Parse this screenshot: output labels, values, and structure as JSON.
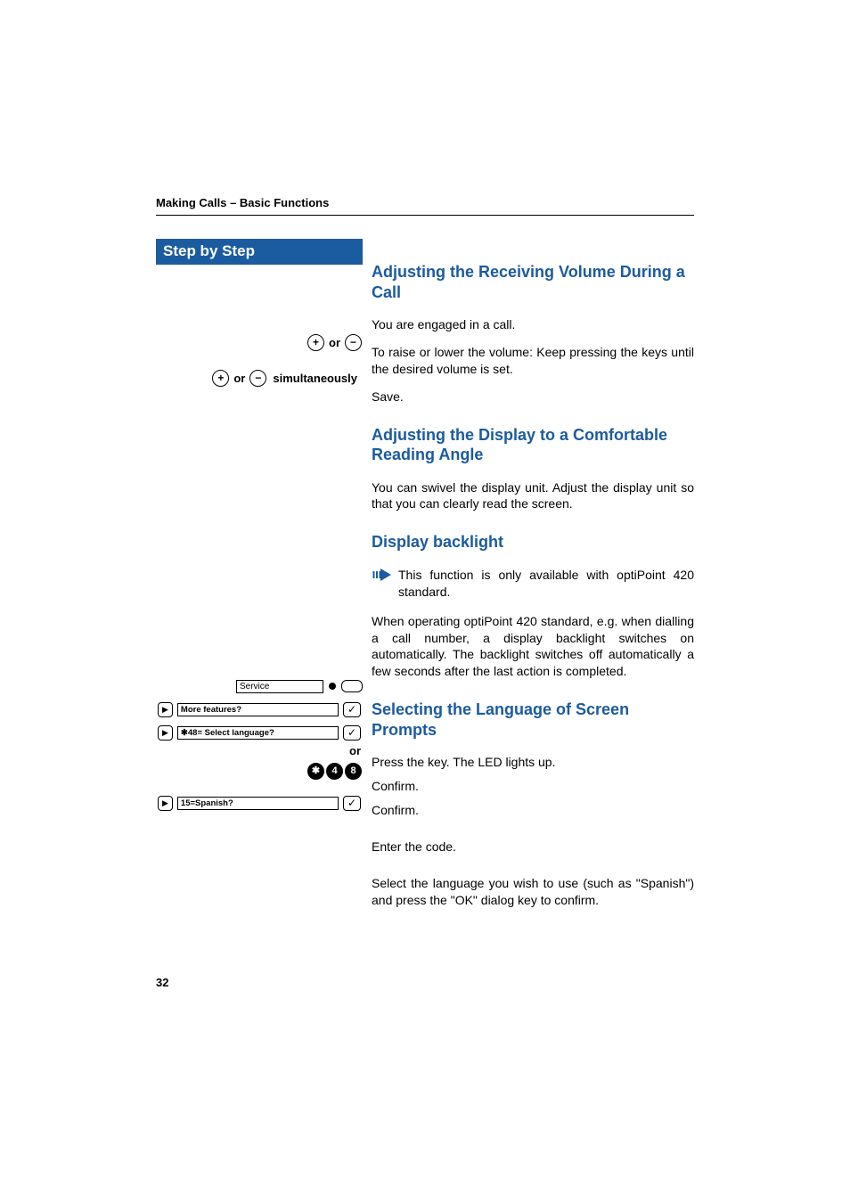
{
  "running_head": "Making Calls – Basic Functions",
  "step_by_step": "Step by Step",
  "page_number": "32",
  "icons": {
    "plus": "+",
    "minus": "−",
    "star": "✱",
    "digit4": "4",
    "digit8": "8",
    "check": "✓",
    "play": "▶"
  },
  "left": {
    "row1": {
      "or": "or"
    },
    "row2": {
      "or": "or",
      "simul": "simultaneously"
    },
    "service_label": "Service",
    "menu_more": "More features?",
    "menu_lang": "48= Select language?",
    "or_text": "or",
    "menu_spanish": "15=Spanish?"
  },
  "sections": {
    "volume": {
      "title": "Adjusting the Receiving Volume During a Call",
      "p1": "You are engaged in a call.",
      "p2": "To raise or lower the volume: Keep pressing the keys until the desired volume is set.",
      "p3": "Save."
    },
    "angle": {
      "title": "Adjusting the Display to a Comfortable Reading Angle",
      "p1": "You can swivel the display unit. Adjust the display unit so that you can clearly read the screen."
    },
    "backlight": {
      "title": "Display backlight",
      "note": "This function is only available with optiPoint 420 standard.",
      "p1": "When operating optiPoint 420 standard, e.g. when dialling a call number, a display backlight switches on automatically. The backlight switches off automatically a few seconds after the last action is completed."
    },
    "language": {
      "title": "Selecting the Language of Screen Prompts",
      "p1": "Press the key. The LED lights up.",
      "p2": "Confirm.",
      "p3": "Confirm.",
      "p4": "Enter the code.",
      "p5": "Select the language you wish to use (such as \"Spanish\") and press the \"OK\" dialog key to confirm."
    }
  }
}
